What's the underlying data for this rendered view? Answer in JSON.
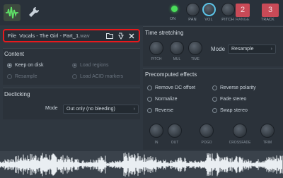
{
  "topbar": {
    "on_label": "ON",
    "pan_label": "PAN",
    "vol_label": "VOL",
    "pitch_label": "PITCH",
    "range_value": "2",
    "range_label": "RANGE",
    "track_value": "3",
    "track_label": "TRACK"
  },
  "file": {
    "label": "File",
    "name": "Vocals - The Girl - Part_1",
    "ext": ".wav"
  },
  "content": {
    "title": "Content",
    "keep_on_disk": "Keep on disk",
    "resample": "Resample",
    "load_regions": "Load regions",
    "load_acid": "Load ACID markers"
  },
  "declicking": {
    "title": "Declicking",
    "mode_label": "Mode",
    "mode_value": "Out only (no bleeding)"
  },
  "time_stretching": {
    "title": "Time stretching",
    "pitch_label": "PITCH",
    "mul_label": "MUL",
    "time_label": "TIME",
    "mode_label": "Mode",
    "mode_value": "Resample"
  },
  "precomputed": {
    "title": "Precomputed effects",
    "remove_dc": "Remove DC offset",
    "reverse_polarity": "Reverse polarity",
    "normalize": "Normalize",
    "fade_stereo": "Fade stereo",
    "reverse": "Reverse",
    "swap_stereo": "Swap stereo",
    "in_label": "IN",
    "out_label": "OUT",
    "pogo_label": "POGO",
    "crossfade_label": "CROSSFADE",
    "trim_label": "TRIM"
  },
  "colors": {
    "accent_green": "#4ade5a",
    "highlight_red": "#e8191c",
    "counter_red": "#c94a57",
    "waveform": "#e9eef2"
  }
}
